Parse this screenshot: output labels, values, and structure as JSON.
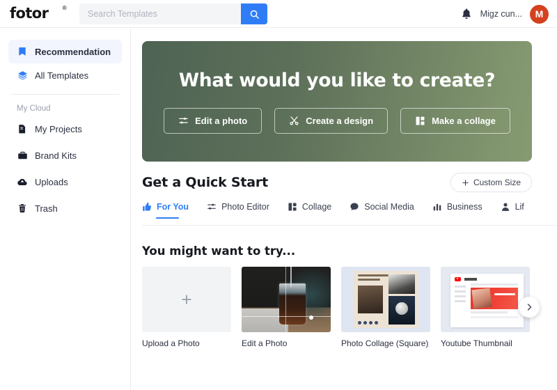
{
  "brand": {
    "name": "fotor",
    "registered": "®"
  },
  "search": {
    "value": "",
    "placeholder": "Search Templates",
    "icon": "search-icon"
  },
  "account": {
    "notification_icon": "bell-icon",
    "username": "Migz cun...",
    "avatar_initial": "M",
    "avatar_color": "#d4411e"
  },
  "sidebar": {
    "primary": [
      {
        "label": "Recommendation",
        "icon": "bookmark-icon",
        "active": true
      },
      {
        "label": "All Templates",
        "icon": "layers-icon",
        "active": false
      }
    ],
    "group_label": "My Cloud",
    "cloud": [
      {
        "label": "My Projects",
        "icon": "document-icon"
      },
      {
        "label": "Brand Kits",
        "icon": "briefcase-icon"
      },
      {
        "label": "Uploads",
        "icon": "cloud-upload-icon"
      },
      {
        "label": "Trash",
        "icon": "trash-icon"
      }
    ]
  },
  "hero": {
    "title": "What would you like to create?",
    "gradient_from": "#4e6354",
    "gradient_to": "#879b72",
    "buttons": [
      {
        "label": "Edit a photo",
        "icon": "sliders-icon"
      },
      {
        "label": "Create a design",
        "icon": "scissors-icon"
      },
      {
        "label": "Make a collage",
        "icon": "collage-icon"
      }
    ]
  },
  "quick_start": {
    "title": "Get a Quick Start",
    "custom_size_label": "Custom Size",
    "custom_size_icon": "plus-icon",
    "accent_color": "#2f7df6",
    "tabs": [
      {
        "label": "For You",
        "icon": "thumbs-up-icon",
        "active": true
      },
      {
        "label": "Photo Editor",
        "icon": "sliders-icon",
        "active": false
      },
      {
        "label": "Collage",
        "icon": "collage-icon",
        "active": false
      },
      {
        "label": "Social Media",
        "icon": "chat-icon",
        "active": false
      },
      {
        "label": "Business",
        "icon": "chart-icon",
        "active": false
      },
      {
        "label": "Lif",
        "icon": "person-icon",
        "active": false
      }
    ]
  },
  "try_section": {
    "title": "You might want to try...",
    "next_icon": "chevron-right-icon",
    "cards": [
      {
        "label": "Upload a Photo",
        "thumb": "upload-placeholder",
        "icon": "plus-icon"
      },
      {
        "label": "Edit a Photo",
        "thumb": "cocktail-photo"
      },
      {
        "label": "Photo Collage (Square)",
        "thumb": "collage-template"
      },
      {
        "label": "Youtube Thumbnail",
        "thumb": "youtube-template"
      }
    ]
  }
}
